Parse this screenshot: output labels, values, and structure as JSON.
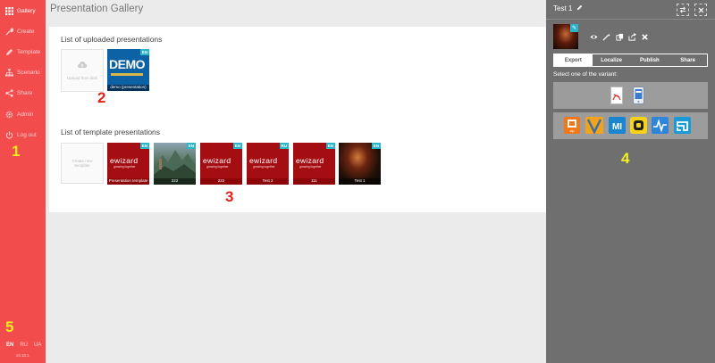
{
  "sidebar": {
    "items": [
      {
        "label": "Gallery",
        "icon": "gallery-icon"
      },
      {
        "label": "Create",
        "icon": "wrench-icon"
      },
      {
        "label": "Template",
        "icon": "pencil-icon"
      },
      {
        "label": "Scenario",
        "icon": "scenario-icon"
      },
      {
        "label": "Share",
        "icon": "share-icon"
      },
      {
        "label": "Admin",
        "icon": "gear-icon"
      },
      {
        "label": "Log out",
        "icon": "power-icon"
      }
    ],
    "languages": [
      "EN",
      "RU",
      "UA"
    ],
    "active_language": "EN",
    "version": "v3.10.1",
    "color": "#f24c4c"
  },
  "main": {
    "title": "Presentation Gallery",
    "uploaded": {
      "title": "List of uploaded presentations",
      "upload_label": "Upload from disk",
      "items": [
        {
          "caption": "demo (presentation)",
          "badge": "EN",
          "thumb_text": "DEMO"
        }
      ]
    },
    "templates": {
      "title": "List of template presentations",
      "create_label": "Create new template",
      "items": [
        {
          "caption": "Presentation template",
          "badge": "EN",
          "logo": "ewizard",
          "tagline": "growing together"
        },
        {
          "caption": "222",
          "badge": "EN"
        },
        {
          "caption": "222",
          "badge": "EN",
          "logo": "ewizard",
          "tagline": "growing together"
        },
        {
          "caption": "Test 2",
          "badge": "RU",
          "logo": "ewizard",
          "tagline": "growing together"
        },
        {
          "caption": "111",
          "badge": "EN",
          "logo": "ewizard",
          "tagline": "growing together"
        },
        {
          "caption": "Test 1",
          "badge": "EN"
        }
      ]
    }
  },
  "panel": {
    "title": "Test 1",
    "swap_icon": "swap-icon",
    "close_icon": "close-icon",
    "tabs": [
      "Export",
      "Localize",
      "Publish",
      "Share"
    ],
    "active_tab": "Export",
    "variant_label": "Select one of the variant:",
    "variants": [
      "pdf-icon",
      "mobile-icon"
    ],
    "targets": [
      "zip-icon",
      "veeva-icon",
      "mi-icon",
      "app-icon",
      "pulse-icon",
      "abbott-icon"
    ]
  },
  "annotations": {
    "n1": "1",
    "n2": "2",
    "n3": "3",
    "n4": "4",
    "n5": "5",
    "red": "#e3211c",
    "yellow": "#f7ef1d"
  }
}
